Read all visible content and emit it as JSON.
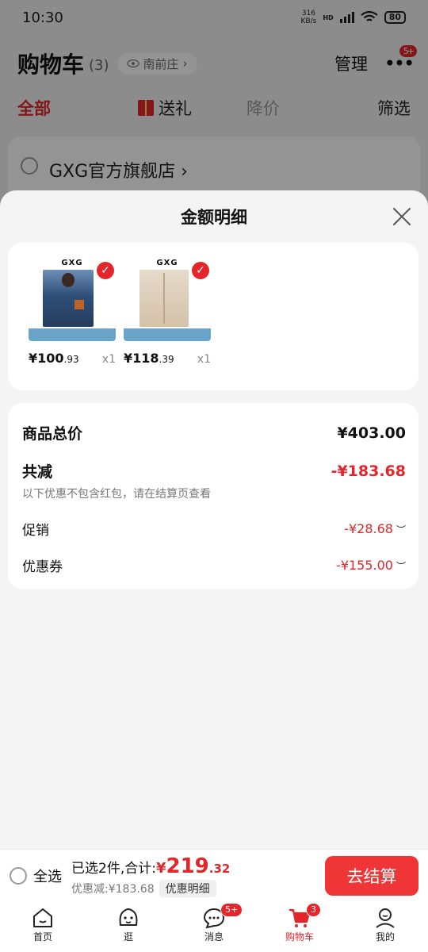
{
  "status_bar": {
    "time": "10:30",
    "net_speed": "316",
    "net_unit": "KB/s",
    "hd": "HD",
    "battery": "80"
  },
  "cart": {
    "title": "购物车",
    "count": "(3)",
    "location": "南前庄",
    "manage": "管理",
    "more_badge": "5+"
  },
  "filter_tabs": {
    "all": "全部",
    "gift": "送礼",
    "price_drop": "降价",
    "filter": "筛选"
  },
  "store": {
    "name": "GXG官方旗舰店"
  },
  "sheet": {
    "title": "金额明细",
    "products": [
      {
        "brand": "GXG",
        "price_int": "¥100",
        "price_dec": ".93",
        "qty": "x1",
        "selected": true
      },
      {
        "brand": "GXG",
        "price_int": "¥118",
        "price_dec": ".39",
        "qty": "x1",
        "selected": true
      }
    ],
    "summary": {
      "total_label": "商品总价",
      "total_value": "¥403.00",
      "reduce_label": "共减",
      "reduce_value": "-¥183.68",
      "note": "以下优惠不包含红包，请在结算页查看",
      "promo_label": "促销",
      "promo_value": "-¥28.68",
      "coupon_label": "优惠券",
      "coupon_value": "-¥155.00"
    }
  },
  "action_bar": {
    "select_all": "全选",
    "selected_text": "已选2件,合计:",
    "total_yen": "¥",
    "total_int": "219",
    "total_dec": ".32",
    "discount_text": "优惠减:¥183.68",
    "detail_button": "优惠明细",
    "checkout": "去结算"
  },
  "tab_bar": [
    {
      "label": "首页",
      "icon": "home-icon"
    },
    {
      "label": "逛",
      "icon": "browse-icon"
    },
    {
      "label": "消息",
      "icon": "message-icon",
      "badge": "5+"
    },
    {
      "label": "购物车",
      "icon": "cart-icon",
      "badge": "3",
      "active": true
    },
    {
      "label": "我的",
      "icon": "profile-icon"
    }
  ],
  "colors": {
    "accent": "#e4262b",
    "checkout": "#ef3535"
  }
}
